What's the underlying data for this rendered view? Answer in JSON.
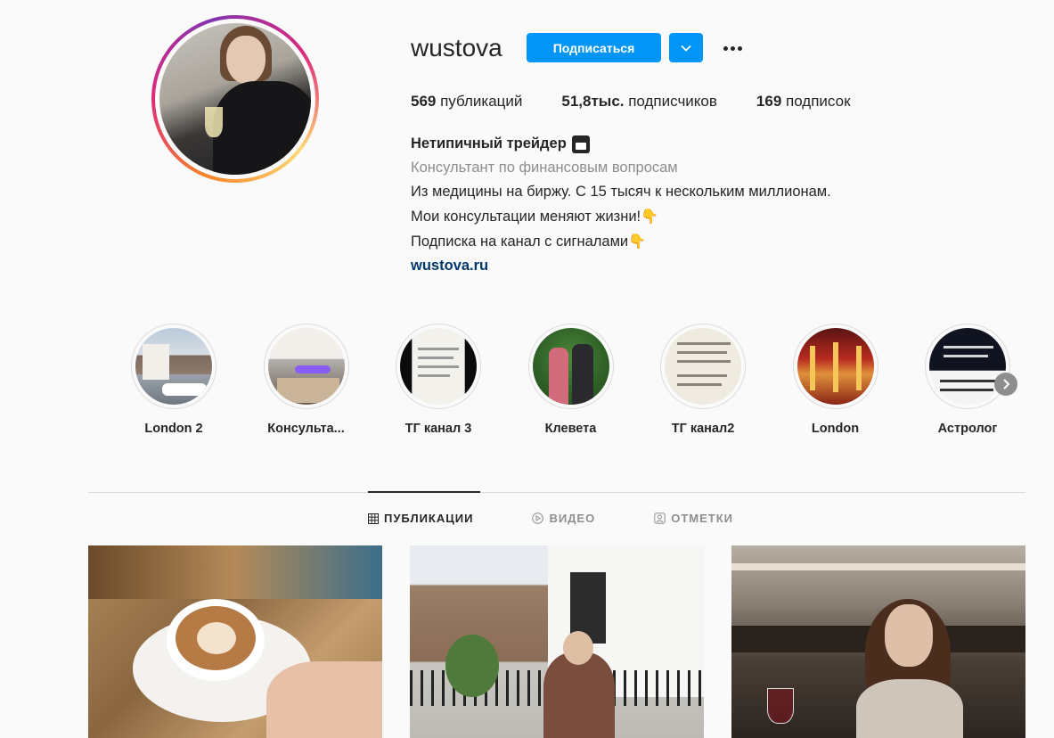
{
  "profile": {
    "username": "wustova",
    "follow_label": "Подписаться",
    "stats": {
      "posts_value": "569",
      "posts_label": " публикаций",
      "followers_value": "51,8тыс.",
      "followers_label": " подписчиков",
      "following_value": "169",
      "following_label": " подписок"
    },
    "bio": {
      "name": "Нетипичный трейдер",
      "category": "Консультант по финансовым вопросам",
      "line1": "Из медицины на биржу. С 15 тысяч к нескольким миллионам.",
      "line2": "Мои консультации меняют жизни!",
      "line3": "Подписка на канал с сигналами",
      "pointer_emoji": "👇",
      "link": "wustova.ru"
    }
  },
  "highlights": [
    {
      "label": "London 2"
    },
    {
      "label": "Консульта..."
    },
    {
      "label": "ТГ канал 3"
    },
    {
      "label": "Клевета"
    },
    {
      "label": "ТГ канал2"
    },
    {
      "label": "London"
    },
    {
      "label": "Астролог"
    }
  ],
  "tabs": [
    {
      "label": "ПУБЛИКАЦИИ",
      "icon": "grid-icon",
      "active": true
    },
    {
      "label": "ВИДЕО",
      "icon": "play-icon",
      "active": false
    },
    {
      "label": "ОТМЕТКИ",
      "icon": "tag-icon",
      "active": false
    }
  ],
  "colors": {
    "accent": "#0095f6",
    "link": "#00376b",
    "muted": "#8e8e8e",
    "text": "#262626",
    "background": "#fafafa"
  }
}
